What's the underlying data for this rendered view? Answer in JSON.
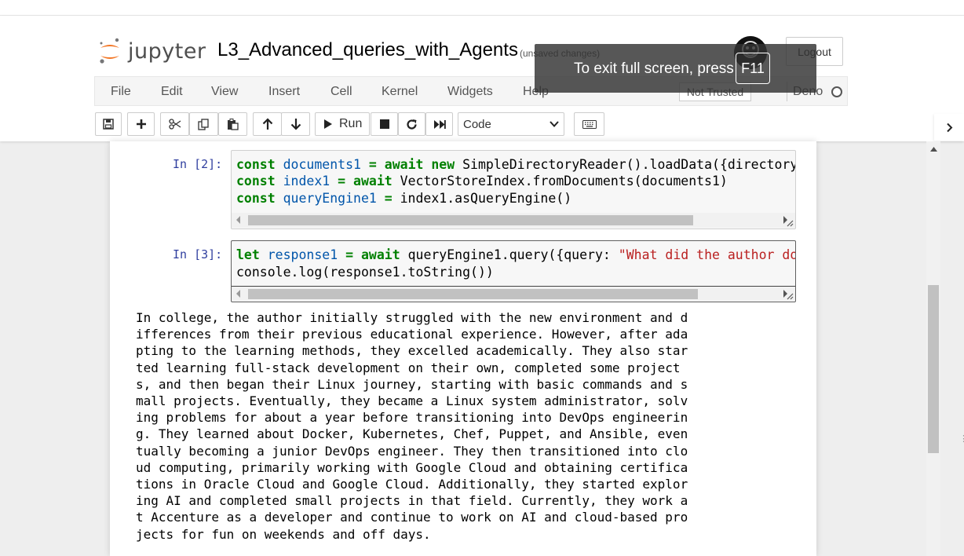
{
  "app": {
    "logo_text": "jupyter",
    "notebook_title": "L3_Advanced_queries_with_Agents",
    "save_status": "(unsaved changes)",
    "logout_label": "Logout"
  },
  "menu": {
    "items": [
      "File",
      "Edit",
      "View",
      "Insert",
      "Cell",
      "Kernel",
      "Widgets",
      "Help"
    ],
    "trust_label": "Not Trusted",
    "kernel_name": "Deno"
  },
  "toolbar": {
    "run_label": "Run",
    "cell_type": "Code",
    "icons": [
      "save-icon",
      "add-cell-icon",
      "cut-icon",
      "copy-icon",
      "paste-icon",
      "move-up-icon",
      "move-down-icon",
      "run-icon",
      "stop-icon",
      "restart-icon",
      "fast-forward-icon",
      "keyboard-icon"
    ]
  },
  "fullscreen_notice": {
    "text": "To exit full screen, press",
    "key": "F11"
  },
  "cells": [
    {
      "prompt": "In [2]:",
      "lines": [
        [
          "const",
          " documents1",
          " = ",
          "await",
          " ",
          "new",
          " SimpleDirectoryReader().loadData({directoryPa"
        ],
        [
          "const",
          " index1",
          " = ",
          "await",
          " VectorStoreIndex.fromDocuments(documents1)"
        ],
        [
          "const",
          " queryEngine1",
          " = ",
          "index1.asQueryEngine()"
        ]
      ]
    },
    {
      "prompt": "In [3]:",
      "lines": [
        [
          "let",
          " response1",
          " = ",
          "await",
          " queryEngine1.query({query: ",
          "\"What did the author do i"
        ],
        [
          "console.log(response1.toString())"
        ]
      ]
    }
  ],
  "output": {
    "lines": [
      "In college, the author initially struggled with the new environment and d",
      "ifferences from their previous educational experience. However, after ada",
      "pting to the learning methods, they excelled academically. They also star",
      "ted learning full-stack development on their own, completed some project",
      "s, and then began their Linux journey, starting with basic commands and s",
      "mall projects. Eventually, they became a Linux system administrator, solv",
      "ing problems for about a year before transitioning into DevOps engineerin",
      "g. They learned about Docker, Kubernetes, Chef, Puppet, and Ansible, even",
      "tually becoming a junior DevOps engineer. They then transitioned into clo",
      "ud computing, primarily working with Google Cloud and obtaining certifica",
      "tions in Oracle Cloud and Google Cloud. Additionally, they started explor",
      "ing AI and completed small projects in that field. Currently, they work a",
      "t Accenture as a developer and continue to work on AI and cloud-based pro",
      "jects for fun on weekends and off days."
    ]
  },
  "colors": {
    "prompt": "#303f9f",
    "keyword": "#008000",
    "variable": "#0055aa",
    "string": "#ba2121",
    "logo_orange": "#f37726"
  }
}
